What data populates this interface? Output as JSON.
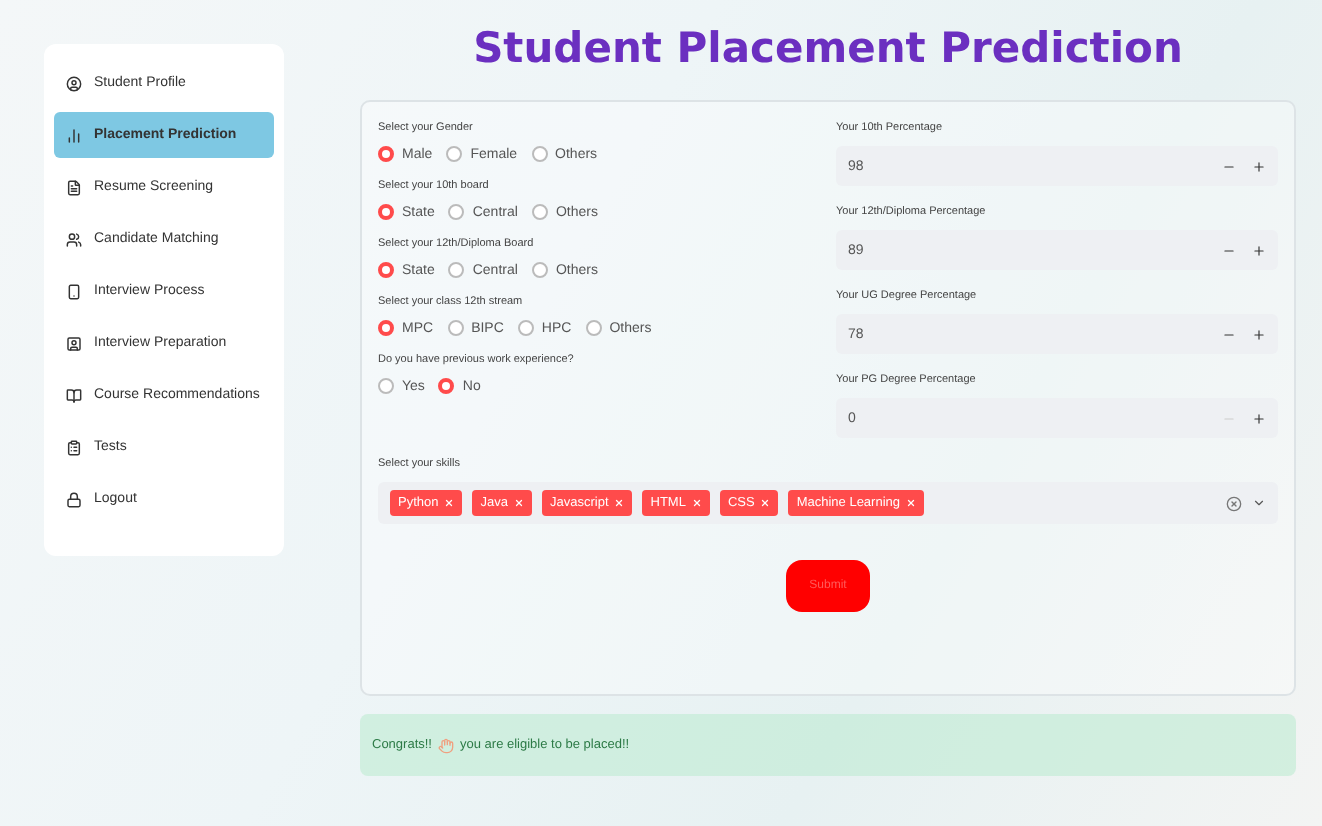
{
  "sidebar": {
    "items": [
      {
        "label": "Student Profile",
        "selected": false
      },
      {
        "label": "Placement Prediction",
        "selected": true
      },
      {
        "label": "Resume Screening",
        "selected": false
      },
      {
        "label": "Candidate Matching",
        "selected": false
      },
      {
        "label": "Interview Process",
        "selected": false
      },
      {
        "label": "Interview Preparation",
        "selected": false
      },
      {
        "label": "Course Recommendations",
        "selected": false
      },
      {
        "label": "Tests",
        "selected": false
      },
      {
        "label": "Logout",
        "selected": false
      }
    ]
  },
  "title": "Student Placement Prediction",
  "form": {
    "radio_groups": [
      {
        "label": "Select your Gender",
        "options": [
          {
            "label": "Male",
            "selected": true
          },
          {
            "label": "Female",
            "selected": false
          },
          {
            "label": "Others",
            "selected": false
          }
        ]
      },
      {
        "label": "Select your 10th board",
        "options": [
          {
            "label": "State",
            "selected": true
          },
          {
            "label": "Central",
            "selected": false
          },
          {
            "label": "Others",
            "selected": false
          }
        ]
      },
      {
        "label": "Select your 12th/Diploma Board",
        "options": [
          {
            "label": "State",
            "selected": true
          },
          {
            "label": "Central",
            "selected": false
          },
          {
            "label": "Others",
            "selected": false
          }
        ]
      },
      {
        "label": "Select your class 12th stream",
        "options": [
          {
            "label": "MPC",
            "selected": true
          },
          {
            "label": "BIPC",
            "selected": false
          },
          {
            "label": "HPC",
            "selected": false
          },
          {
            "label": "Others",
            "selected": false
          }
        ]
      },
      {
        "label": "Do you have previous work experience?",
        "options": [
          {
            "label": "Yes",
            "selected": false
          },
          {
            "label": "No",
            "selected": true
          }
        ]
      }
    ],
    "number_inputs": [
      {
        "label": "Your 10th Percentage",
        "value": "98",
        "minus_disabled": false
      },
      {
        "label": "Your 12th/Diploma Percentage",
        "value": "89",
        "minus_disabled": false
      },
      {
        "label": "Your UG Degree Percentage",
        "value": "78",
        "minus_disabled": false
      },
      {
        "label": "Your PG Degree Percentage",
        "value": "0",
        "minus_disabled": true
      }
    ],
    "skills": {
      "label": "Select your skills",
      "tags": [
        "Python",
        "Java",
        "Javascript",
        "HTML",
        "CSS",
        "Machine Learning"
      ]
    },
    "submit": "Submit"
  },
  "alert": {
    "before": "Congrats!!",
    "after": "you are eligible to be placed!!"
  }
}
